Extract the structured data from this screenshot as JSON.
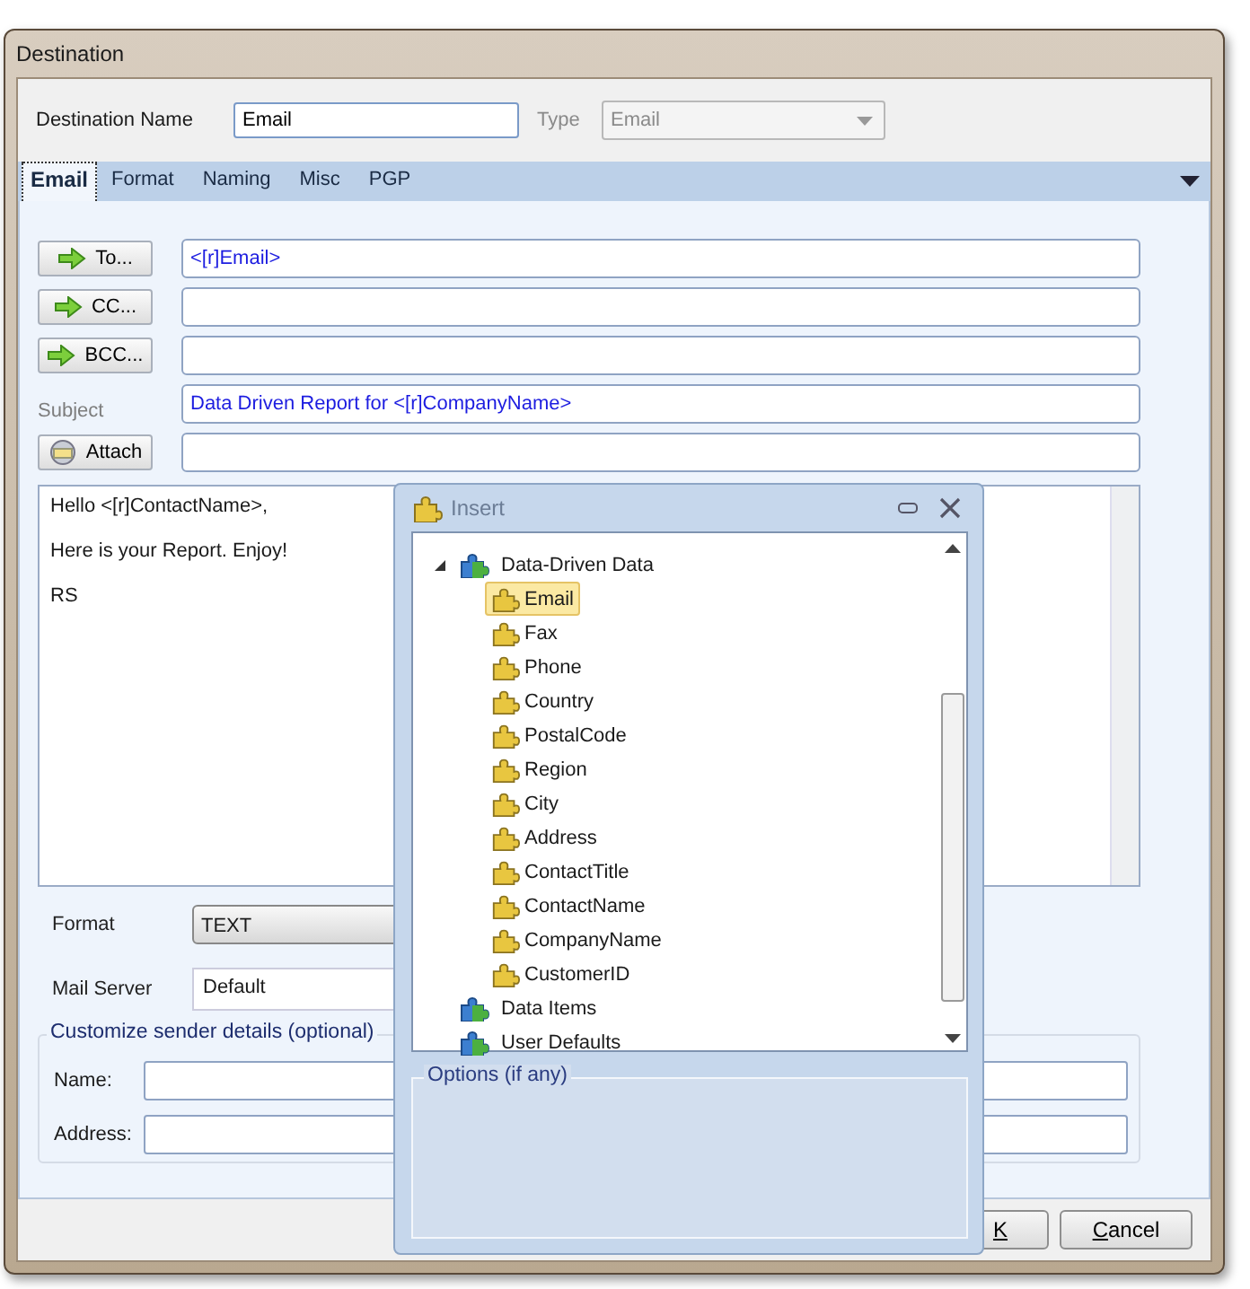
{
  "window": {
    "title": "Destination"
  },
  "destination_name": {
    "label": "Destination Name",
    "value": "Email"
  },
  "type": {
    "label": "Type",
    "value": "Email",
    "disabled": true
  },
  "tabs": [
    {
      "label": "Email",
      "selected": true
    },
    {
      "label": "Format",
      "selected": false
    },
    {
      "label": "Naming",
      "selected": false
    },
    {
      "label": "Misc",
      "selected": false
    },
    {
      "label": "PGP",
      "selected": false
    }
  ],
  "recipients": [
    {
      "kind": "button",
      "label": "To...",
      "value": "<[r]Email>"
    },
    {
      "kind": "button",
      "label": "CC..."
    },
    {
      "kind": "button",
      "label": "BCC..."
    },
    {
      "kind": "label",
      "label": "Subject",
      "value": "Data Driven Report for <[r]CompanyName>"
    },
    {
      "kind": "attach",
      "label": "Attach"
    }
  ],
  "body_lines": [
    "Hello <[r]ContactName>,",
    "Here is your Report. Enjoy!",
    "RS"
  ],
  "format": {
    "label": "Format",
    "value": "TEXT"
  },
  "mail_server": {
    "label": "Mail Server",
    "value": "Default"
  },
  "sender": {
    "title": "Customize sender details (optional)",
    "fields": [
      {
        "label": "Name:"
      },
      {
        "label": "Address:"
      }
    ]
  },
  "buttons": [
    {
      "label": "K"
    },
    {
      "label": "Cancel"
    }
  ],
  "insert": {
    "title": "Insert",
    "tree": [
      {
        "label": "Data-Driven Data",
        "kind": "group",
        "expanded": true,
        "selected": false,
        "children": [
          {
            "label": "Email",
            "kind": "field",
            "selected": true
          },
          {
            "label": "Fax",
            "kind": "field",
            "selected": false
          },
          {
            "label": "Phone",
            "kind": "field",
            "selected": false
          },
          {
            "label": "Country",
            "kind": "field",
            "selected": false
          },
          {
            "label": "PostalCode",
            "kind": "field",
            "selected": false
          },
          {
            "label": "Region",
            "kind": "field",
            "selected": false
          },
          {
            "label": "City",
            "kind": "field",
            "selected": false
          },
          {
            "label": "Address",
            "kind": "field",
            "selected": false
          },
          {
            "label": "ContactTitle",
            "kind": "field",
            "selected": false
          },
          {
            "label": "ContactName",
            "kind": "field",
            "selected": false
          },
          {
            "label": "CompanyName",
            "kind": "field",
            "selected": false
          },
          {
            "label": "CustomerID",
            "kind": "field",
            "selected": false
          }
        ]
      },
      {
        "label": "Data Items",
        "kind": "group",
        "expanded": false,
        "selected": false
      },
      {
        "label": "User Defaults",
        "kind": "group",
        "expanded": false,
        "selected": false
      }
    ],
    "options_title": "Options (if any)"
  }
}
